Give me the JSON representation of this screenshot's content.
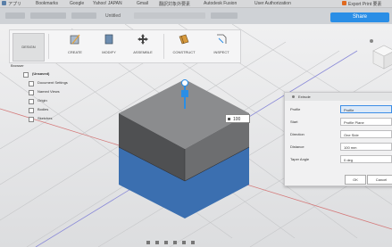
{
  "browser_bar": {
    "items": [
      "アプリ",
      "Bookmarks",
      "Google",
      "Yahoo! JAPAN",
      "Gmail",
      "翻訳対象外要素",
      "Autodesk Fusion",
      "User Authorization",
      "Export Print 要素"
    ]
  },
  "app_bar": {
    "document_title": "Untitled",
    "share_label": "Share"
  },
  "toolbar": {
    "workspace_label": "DESIGN",
    "tools": [
      {
        "label": "CREATE",
        "icon": "sketch-icon"
      },
      {
        "label": "MODIFY",
        "icon": "box-icon"
      },
      {
        "label": "ASSEMBLE",
        "icon": "move-icon"
      },
      {
        "label": "CONSTRUCT",
        "icon": "plane-icon"
      },
      {
        "label": "INSPECT",
        "icon": "measure-icon"
      }
    ]
  },
  "browser": {
    "title": "Browser",
    "items": [
      {
        "label": "(Unsaved)"
      },
      {
        "label": "Document Settings"
      },
      {
        "label": "Named Views"
      },
      {
        "label": "Origin"
      },
      {
        "label": "Bodies"
      },
      {
        "label": "Sketches"
      }
    ]
  },
  "distance_input": {
    "value": "100"
  },
  "dialog": {
    "title": "Extrude",
    "rows": [
      {
        "label": "Profile",
        "value": "Profile"
      },
      {
        "label": "Start",
        "value": "Profile Plane"
      },
      {
        "label": "Direction",
        "value": "One Side"
      },
      {
        "label": "Distance",
        "value": "100 mm"
      },
      {
        "label": "Taper Angle",
        "value": "0 deg"
      }
    ],
    "ok_label": "OK",
    "cancel_label": "Cancel"
  },
  "colors": {
    "selected_face": "#3b6fb0",
    "body_gray": "#6a6b6d",
    "accent": "#2a8ee6"
  }
}
